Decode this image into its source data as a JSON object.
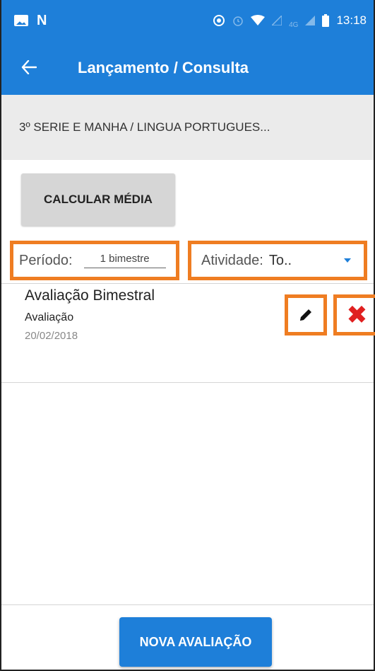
{
  "status_bar": {
    "network_label": "4G",
    "time": "13:18",
    "icons": [
      "image-icon",
      "n-icon",
      "location-icon",
      "alarm-icon",
      "wifi-icon",
      "signal-icon",
      "battery-icon"
    ]
  },
  "app_bar": {
    "title": "Lançamento / Consulta",
    "back_icon": "arrow-left-icon"
  },
  "class_selector": {
    "value": "3º SERIE E  MANHA / LINGUA PORTUGUES..."
  },
  "actions": {
    "calculate_label": "CALCULAR MÉDIA",
    "new_label": "NOVA AVALIAÇÃO"
  },
  "filters": {
    "period_label": "Período:",
    "period_value": "1 bimestre",
    "activity_label": "Atividade:",
    "activity_value": "To.."
  },
  "evaluations": [
    {
      "title": "Avaliação Bimestral",
      "type": "Avaliação",
      "date": "20/02/2018",
      "edit_icon": "pencil-icon",
      "delete_icon": "delete-x-icon"
    }
  ],
  "colors": {
    "primary": "#1e7fd9",
    "highlight": "#ef7d22",
    "delete": "#e02020"
  }
}
